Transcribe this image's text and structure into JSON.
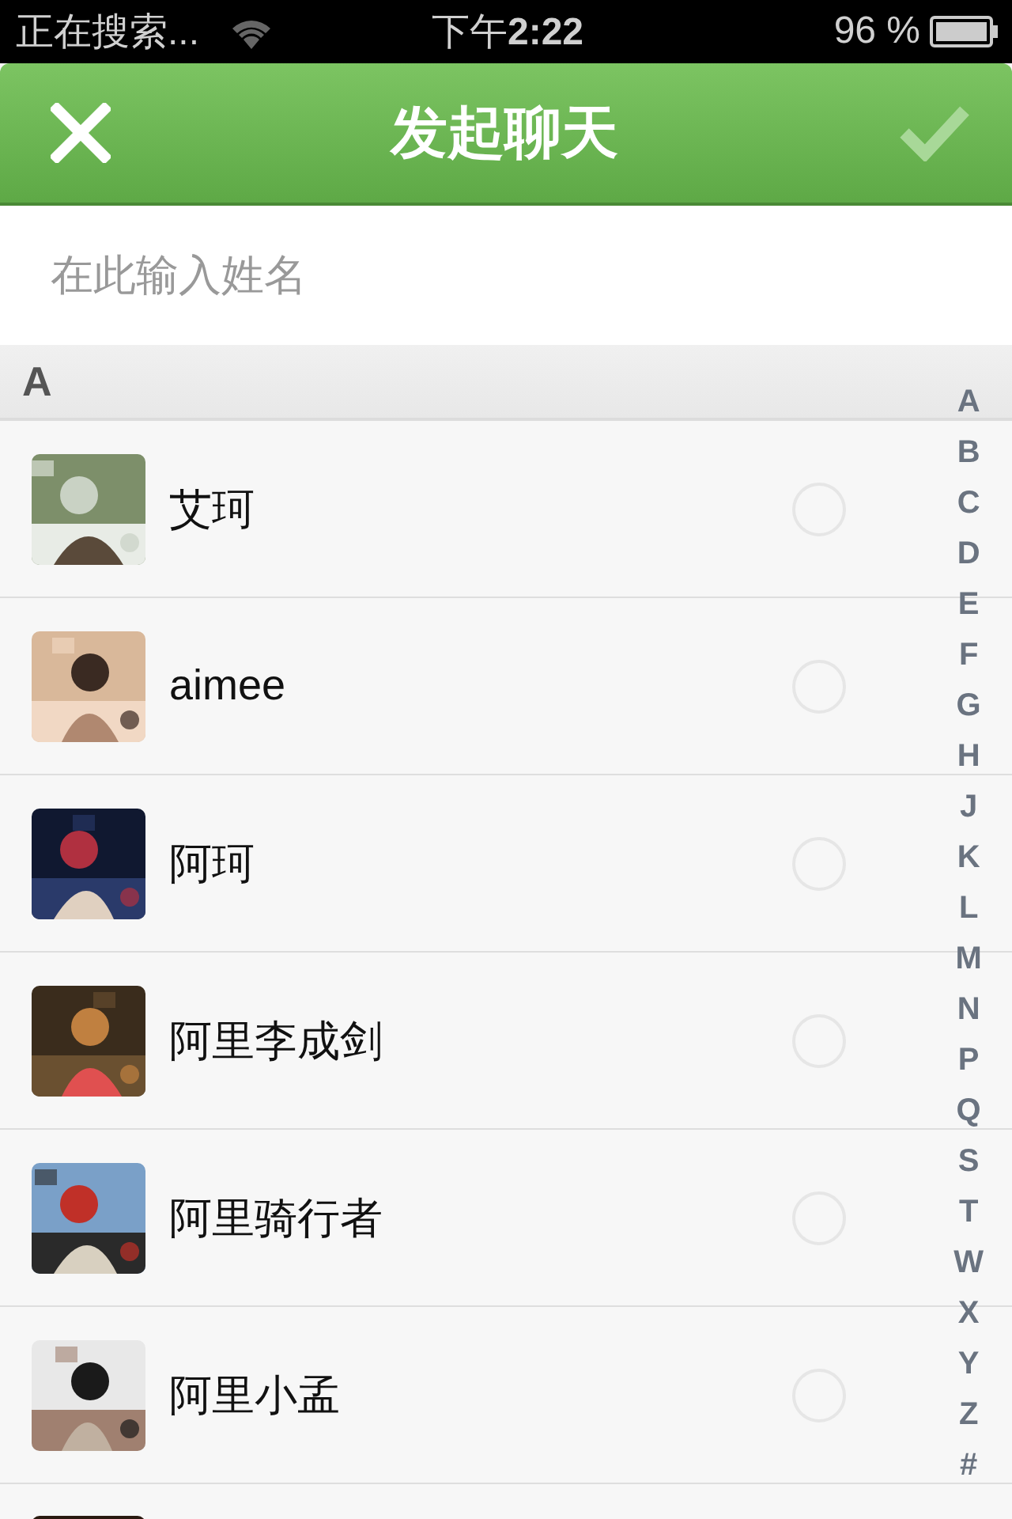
{
  "status_bar": {
    "carrier": "正在搜索...",
    "time": "下午**2:22**",
    "battery": "96 %"
  },
  "header": {
    "title": "发起聊天",
    "confirm_enabled": false
  },
  "search": {
    "placeholder": "在此输入姓名"
  },
  "sections": [
    {
      "letter": "A",
      "contacts": [
        {
          "name": "艾珂",
          "selected": false
        },
        {
          "name": "aimee",
          "selected": false
        },
        {
          "name": "阿珂",
          "selected": false
        },
        {
          "name": "阿里李成剑",
          "selected": false
        },
        {
          "name": "阿里骑行者",
          "selected": false
        },
        {
          "name": "阿里小孟",
          "selected": false
        }
      ]
    }
  ],
  "index_letters": [
    "A",
    "B",
    "C",
    "D",
    "E",
    "F",
    "G",
    "H",
    "J",
    "K",
    "L",
    "M",
    "N",
    "P",
    "Q",
    "S",
    "T",
    "W",
    "X",
    "Y",
    "Z",
    "#"
  ]
}
